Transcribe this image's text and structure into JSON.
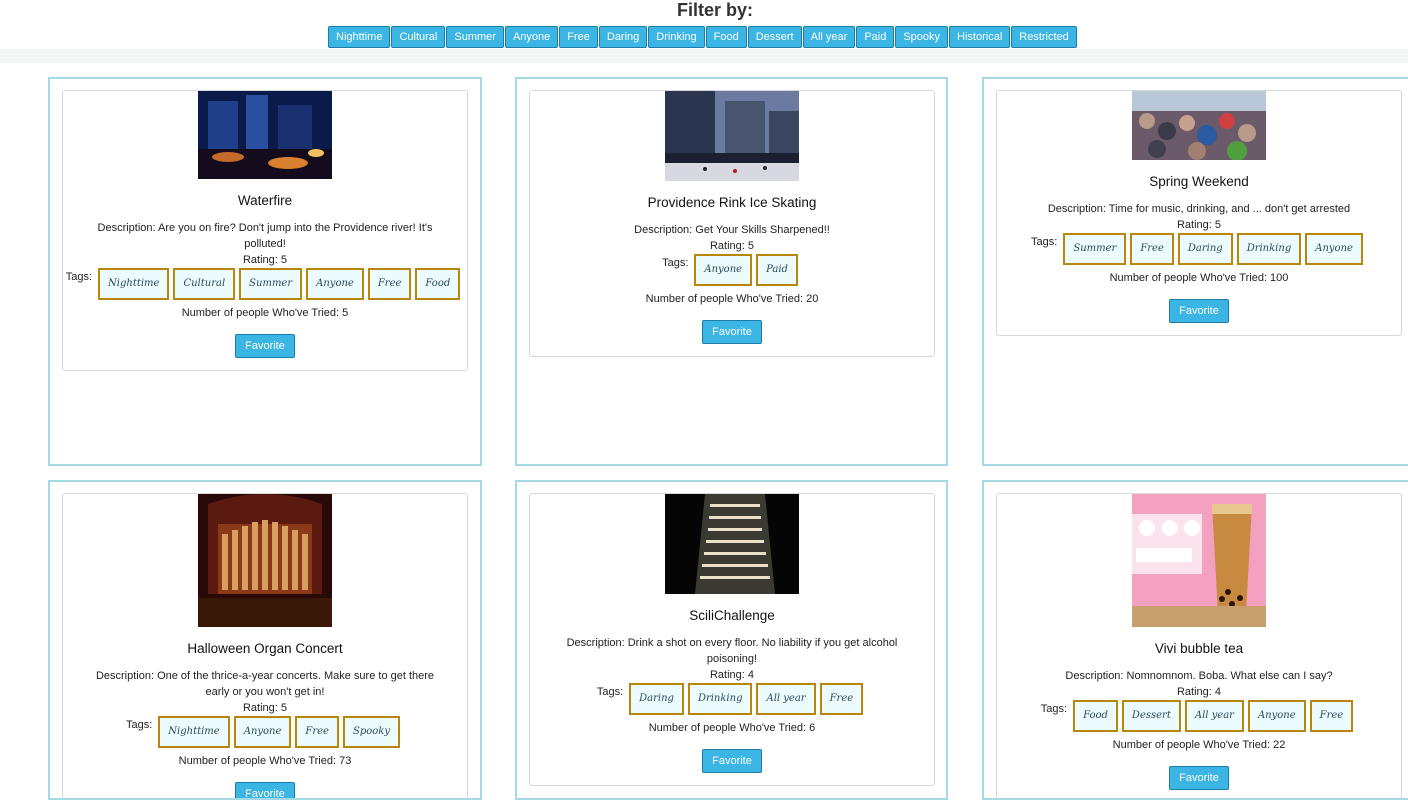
{
  "filter": {
    "title": "Filter by:",
    "buttons": [
      "Nighttime",
      "Cultural",
      "Summer",
      "Anyone",
      "Free",
      "Daring",
      "Drinking",
      "Food",
      "Dessert",
      "All year",
      "Paid",
      "Spooky",
      "Historical",
      "Restricted"
    ]
  },
  "labels": {
    "tags": "Tags:",
    "favorite": "Favorite"
  },
  "activities": [
    {
      "title": "Waterfire",
      "description": "Description: Are you on fire? Don't jump into the Providence river! It's polluted!",
      "rating": "Rating: 5",
      "tags": [
        "Nighttime",
        "Cultural",
        "Summer",
        "Anyone",
        "Free",
        "Food"
      ],
      "tried": "Number of people Who've Tried: 5",
      "image_colors": [
        "#0a1a4a",
        "#1f3f8a",
        "#c46a2a"
      ]
    },
    {
      "title": "Providence Rink Ice Skating",
      "description": "Description: Get Your Skills Sharpened!!",
      "rating": "Rating: 5",
      "tags": [
        "Anyone",
        "Paid"
      ],
      "tried": "Number of people Who've Tried: 20",
      "image_colors": [
        "#2a3550",
        "#6b7aa0",
        "#d8d8e0"
      ]
    },
    {
      "title": "Spring Weekend",
      "description": "Description: Time for music, drinking, and ... don't get arrested",
      "rating": "Rating: 5",
      "tags": [
        "Summer",
        "Free",
        "Daring",
        "Drinking",
        "Anyone"
      ],
      "tried": "Number of people Who've Tried: 100",
      "image_colors": [
        "#6a5a6a",
        "#b89a8a",
        "#3a3a4a"
      ]
    },
    {
      "title": "Halloween Organ Concert",
      "description": "Description: One of the thrice-a-year concerts. Make sure to get there early or you won't get in!",
      "rating": "Rating: 5",
      "tags": [
        "Nighttime",
        "Anyone",
        "Free",
        "Spooky"
      ],
      "tried": "Number of people Who've Tried: 73",
      "image_colors": [
        "#2a0a08",
        "#8a3a18",
        "#d8a060"
      ]
    },
    {
      "title": "SciliChallenge",
      "description": "Description: Drink a shot on every floor. No liability if you get alcohol poisoning!",
      "rating": "Rating: 4",
      "tags": [
        "Daring",
        "Drinking",
        "All year",
        "Free"
      ],
      "tried": "Number of people Who've Tried: 6",
      "image_colors": [
        "#050505",
        "#3a3a30",
        "#e8e0c8"
      ]
    },
    {
      "title": "Vivi bubble tea",
      "description": "Description: Nomnomnom. Boba. What else can I say?",
      "rating": "Rating: 4",
      "tags": [
        "Food",
        "Dessert",
        "All year",
        "Anyone",
        "Free"
      ],
      "tried": "Number of people Who've Tried: 22",
      "image_colors": [
        "#f4a0c0",
        "#c88a40",
        "#fbe3ee"
      ]
    }
  ]
}
